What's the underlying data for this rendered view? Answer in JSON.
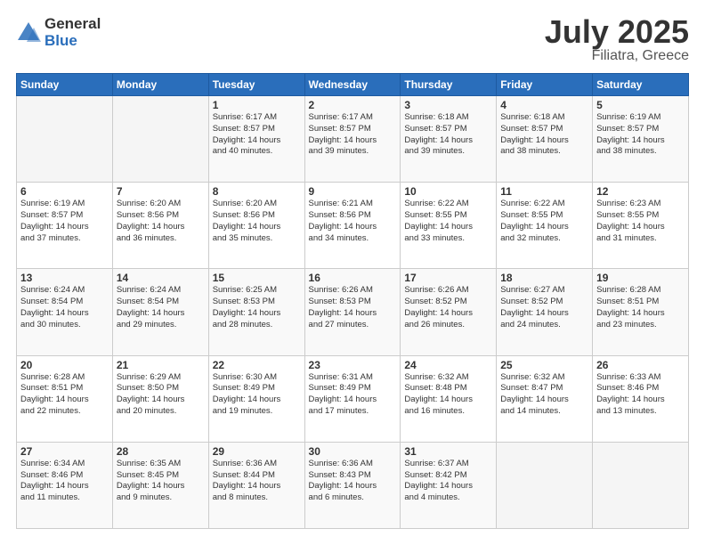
{
  "logo": {
    "general": "General",
    "blue": "Blue"
  },
  "title": {
    "month": "July 2025",
    "location": "Filiatra, Greece"
  },
  "headers": [
    "Sunday",
    "Monday",
    "Tuesday",
    "Wednesday",
    "Thursday",
    "Friday",
    "Saturday"
  ],
  "weeks": [
    [
      {
        "day": "",
        "info": ""
      },
      {
        "day": "",
        "info": ""
      },
      {
        "day": "1",
        "info": "Sunrise: 6:17 AM\nSunset: 8:57 PM\nDaylight: 14 hours\nand 40 minutes."
      },
      {
        "day": "2",
        "info": "Sunrise: 6:17 AM\nSunset: 8:57 PM\nDaylight: 14 hours\nand 39 minutes."
      },
      {
        "day": "3",
        "info": "Sunrise: 6:18 AM\nSunset: 8:57 PM\nDaylight: 14 hours\nand 39 minutes."
      },
      {
        "day": "4",
        "info": "Sunrise: 6:18 AM\nSunset: 8:57 PM\nDaylight: 14 hours\nand 38 minutes."
      },
      {
        "day": "5",
        "info": "Sunrise: 6:19 AM\nSunset: 8:57 PM\nDaylight: 14 hours\nand 38 minutes."
      }
    ],
    [
      {
        "day": "6",
        "info": "Sunrise: 6:19 AM\nSunset: 8:57 PM\nDaylight: 14 hours\nand 37 minutes."
      },
      {
        "day": "7",
        "info": "Sunrise: 6:20 AM\nSunset: 8:56 PM\nDaylight: 14 hours\nand 36 minutes."
      },
      {
        "day": "8",
        "info": "Sunrise: 6:20 AM\nSunset: 8:56 PM\nDaylight: 14 hours\nand 35 minutes."
      },
      {
        "day": "9",
        "info": "Sunrise: 6:21 AM\nSunset: 8:56 PM\nDaylight: 14 hours\nand 34 minutes."
      },
      {
        "day": "10",
        "info": "Sunrise: 6:22 AM\nSunset: 8:55 PM\nDaylight: 14 hours\nand 33 minutes."
      },
      {
        "day": "11",
        "info": "Sunrise: 6:22 AM\nSunset: 8:55 PM\nDaylight: 14 hours\nand 32 minutes."
      },
      {
        "day": "12",
        "info": "Sunrise: 6:23 AM\nSunset: 8:55 PM\nDaylight: 14 hours\nand 31 minutes."
      }
    ],
    [
      {
        "day": "13",
        "info": "Sunrise: 6:24 AM\nSunset: 8:54 PM\nDaylight: 14 hours\nand 30 minutes."
      },
      {
        "day": "14",
        "info": "Sunrise: 6:24 AM\nSunset: 8:54 PM\nDaylight: 14 hours\nand 29 minutes."
      },
      {
        "day": "15",
        "info": "Sunrise: 6:25 AM\nSunset: 8:53 PM\nDaylight: 14 hours\nand 28 minutes."
      },
      {
        "day": "16",
        "info": "Sunrise: 6:26 AM\nSunset: 8:53 PM\nDaylight: 14 hours\nand 27 minutes."
      },
      {
        "day": "17",
        "info": "Sunrise: 6:26 AM\nSunset: 8:52 PM\nDaylight: 14 hours\nand 26 minutes."
      },
      {
        "day": "18",
        "info": "Sunrise: 6:27 AM\nSunset: 8:52 PM\nDaylight: 14 hours\nand 24 minutes."
      },
      {
        "day": "19",
        "info": "Sunrise: 6:28 AM\nSunset: 8:51 PM\nDaylight: 14 hours\nand 23 minutes."
      }
    ],
    [
      {
        "day": "20",
        "info": "Sunrise: 6:28 AM\nSunset: 8:51 PM\nDaylight: 14 hours\nand 22 minutes."
      },
      {
        "day": "21",
        "info": "Sunrise: 6:29 AM\nSunset: 8:50 PM\nDaylight: 14 hours\nand 20 minutes."
      },
      {
        "day": "22",
        "info": "Sunrise: 6:30 AM\nSunset: 8:49 PM\nDaylight: 14 hours\nand 19 minutes."
      },
      {
        "day": "23",
        "info": "Sunrise: 6:31 AM\nSunset: 8:49 PM\nDaylight: 14 hours\nand 17 minutes."
      },
      {
        "day": "24",
        "info": "Sunrise: 6:32 AM\nSunset: 8:48 PM\nDaylight: 14 hours\nand 16 minutes."
      },
      {
        "day": "25",
        "info": "Sunrise: 6:32 AM\nSunset: 8:47 PM\nDaylight: 14 hours\nand 14 minutes."
      },
      {
        "day": "26",
        "info": "Sunrise: 6:33 AM\nSunset: 8:46 PM\nDaylight: 14 hours\nand 13 minutes."
      }
    ],
    [
      {
        "day": "27",
        "info": "Sunrise: 6:34 AM\nSunset: 8:46 PM\nDaylight: 14 hours\nand 11 minutes."
      },
      {
        "day": "28",
        "info": "Sunrise: 6:35 AM\nSunset: 8:45 PM\nDaylight: 14 hours\nand 9 minutes."
      },
      {
        "day": "29",
        "info": "Sunrise: 6:36 AM\nSunset: 8:44 PM\nDaylight: 14 hours\nand 8 minutes."
      },
      {
        "day": "30",
        "info": "Sunrise: 6:36 AM\nSunset: 8:43 PM\nDaylight: 14 hours\nand 6 minutes."
      },
      {
        "day": "31",
        "info": "Sunrise: 6:37 AM\nSunset: 8:42 PM\nDaylight: 14 hours\nand 4 minutes."
      },
      {
        "day": "",
        "info": ""
      },
      {
        "day": "",
        "info": ""
      }
    ]
  ]
}
